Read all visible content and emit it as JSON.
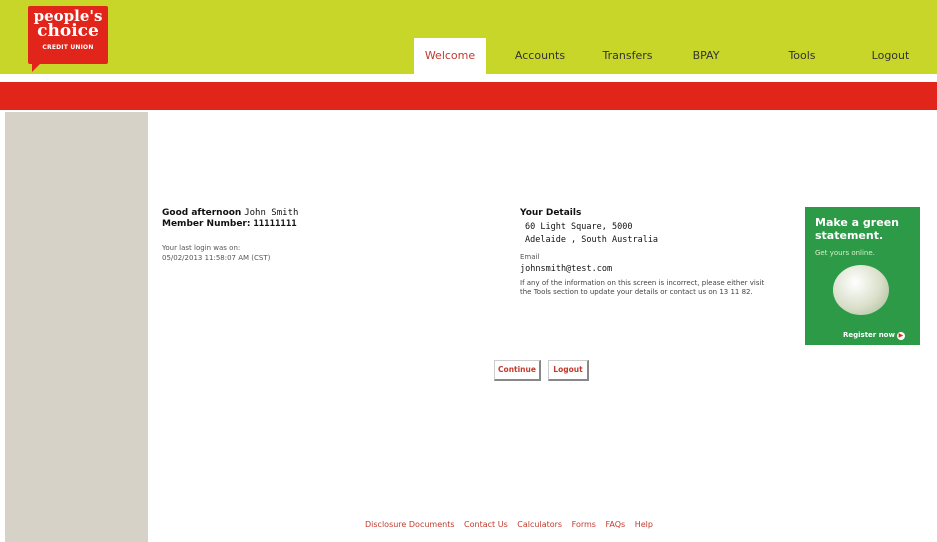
{
  "brand": {
    "line1": "people's",
    "line2": "choice",
    "line3": "CREDIT UNION",
    "primary_color": "#e1251b",
    "header_color": "#c8d62a"
  },
  "nav": {
    "items": [
      "Welcome",
      "Accounts",
      "Transfers",
      "BPAY",
      "Tools",
      "Logout"
    ],
    "active": "Welcome"
  },
  "greeting": {
    "prefix": "Good afternoon",
    "name": "John Smith",
    "member_label": "Member Number:",
    "member_number": "11111111",
    "last_login_label": "Your last login was on:",
    "last_login_value": "05/02/2013 11:58:07 AM (CST)"
  },
  "details": {
    "title": "Your Details",
    "address_line1": "60 Light Square, 5000",
    "address_line2": "Adelaide , South Australia",
    "email_label": "Email",
    "email": "johnsmith@test.com",
    "note": "If any of the information on this screen is incorrect, please either visit the Tools section to update your details or contact us on 13 11 82."
  },
  "buttons": {
    "continue": "Continue",
    "logout": "Logout"
  },
  "ad": {
    "headline": "Make a green statement.",
    "sub": "Get yours online.",
    "cta": "Register now",
    "cta_icon": "arrow-right-icon",
    "bg_color": "#2c9a47"
  },
  "footer": {
    "links": [
      "Disclosure Documents",
      "Contact Us",
      "Calculators",
      "Forms",
      "FAQs",
      "Help"
    ]
  }
}
